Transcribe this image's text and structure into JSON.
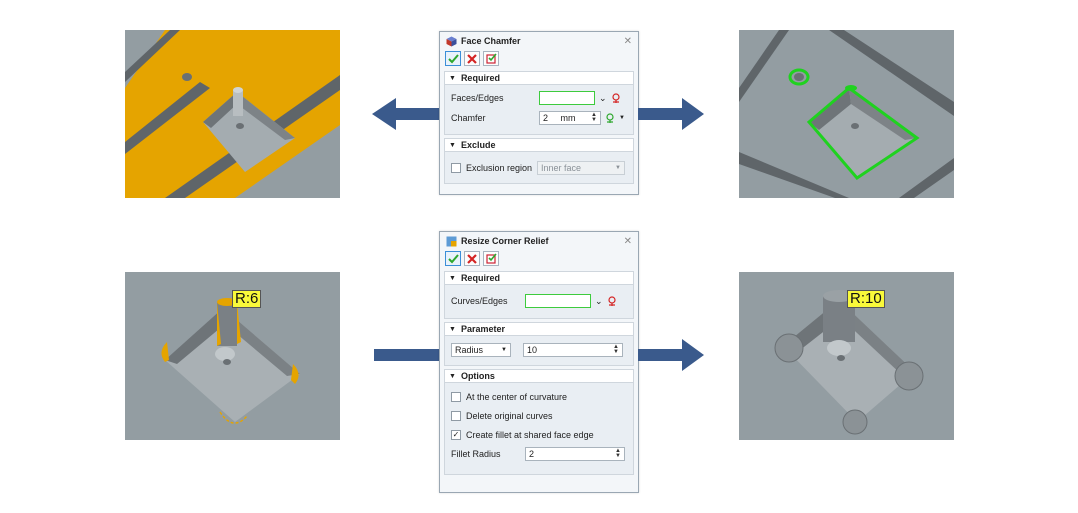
{
  "face_chamfer": {
    "title": "Face Chamfer",
    "close": "✕",
    "required": {
      "header": "Required",
      "faces_edges_label": "Faces/Edges",
      "faces_edges_value": "",
      "chamfer_label": "Chamfer",
      "chamfer_value": "2",
      "chamfer_unit": "mm"
    },
    "exclude": {
      "header": "Exclude",
      "exclusion_label": "Exclusion region",
      "exclusion_checked": false,
      "exclusion_option": "Inner face"
    }
  },
  "resize_corner_relief": {
    "title": "Resize Corner Relief",
    "close": "✕",
    "required": {
      "header": "Required",
      "curves_edges_label": "Curves/Edges",
      "curves_edges_value": ""
    },
    "parameter": {
      "header": "Parameter",
      "type_option": "Radius",
      "value": "10"
    },
    "options": {
      "header": "Options",
      "center_label": "At the center of curvature",
      "center_checked": false,
      "delete_label": "Delete original curves",
      "delete_checked": false,
      "fillet_label": "Create fillet at shared face edge",
      "fillet_checked": true,
      "fillet_radius_label": "Fillet Radius",
      "fillet_radius_value": "2"
    }
  },
  "callouts": {
    "before": "R:6",
    "after": "R:10"
  },
  "colors": {
    "selection_orange": "#e5a400",
    "selection_green": "#1fd21f",
    "arrow_blue": "#3a5a8c",
    "model_gray": "#8f999e"
  }
}
